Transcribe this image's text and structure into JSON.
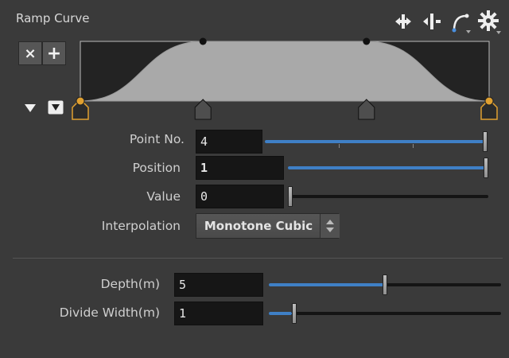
{
  "panel": {
    "title": "Ramp Curve"
  },
  "toolbar": {
    "icons": [
      "move-horizontal-icon",
      "split-point-icon",
      "curve-handle-icon",
      "gear-icon"
    ]
  },
  "ramp_buttons": {
    "remove_label": "×",
    "add_label": "+"
  },
  "ramp": {
    "points": [
      {
        "position": 0,
        "value": 0
      },
      {
        "position": 0.3,
        "value": 1
      },
      {
        "position": 0.7,
        "value": 1
      },
      {
        "position": 1,
        "value": 0
      }
    ],
    "selected_point_index": 3,
    "interpolation": "Monotone Cubic"
  },
  "fields": {
    "point_no": {
      "label": "Point No.",
      "value": "4",
      "fraction": 1.0
    },
    "position": {
      "label": "Position",
      "value": "1",
      "fraction": 1.0
    },
    "value": {
      "label": "Value",
      "value": "0",
      "fraction": 0.0
    },
    "interpolation": {
      "label": "Interpolation",
      "value": "Monotone Cubic"
    },
    "depth": {
      "label": "Depth(m)",
      "value": "5",
      "fraction": 0.5
    },
    "divide_width": {
      "label": "Divide Width(m)",
      "value": "1",
      "fraction": 0.1
    }
  },
  "colors": {
    "accent": "#3f80c6",
    "selected_point": "#e0a030",
    "ramp_fill": "#a9a9a9",
    "ramp_bg": "#232323"
  }
}
